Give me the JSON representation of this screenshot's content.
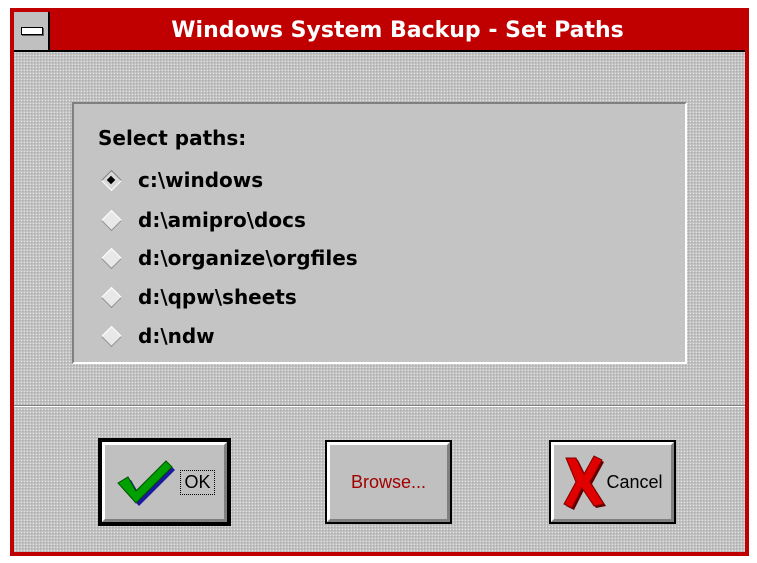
{
  "window": {
    "title": "Windows System Backup - Set Paths",
    "system_menu_icon": "system-menu-icon"
  },
  "paths_group": {
    "label": "Select paths:",
    "options": [
      {
        "label": "c:\\windows",
        "selected": true
      },
      {
        "label": "d:\\amipro\\docs",
        "selected": false
      },
      {
        "label": "d:\\organize\\orgfiles",
        "selected": false
      },
      {
        "label": "d:\\qpw\\sheets",
        "selected": false
      },
      {
        "label": "d:\\ndw",
        "selected": false
      }
    ]
  },
  "buttons": {
    "ok": {
      "label": "OK",
      "icon": "checkmark-icon",
      "default": true
    },
    "browse": {
      "label": "Browse...",
      "label_color": "#a00000"
    },
    "cancel": {
      "label": "Cancel",
      "icon": "red-x-icon"
    }
  },
  "colors": {
    "titlebar": "#c00000",
    "frame": "#c00000",
    "face": "#c0c0c0",
    "checkmark": "#008000",
    "cancel_x": "#e00000"
  }
}
